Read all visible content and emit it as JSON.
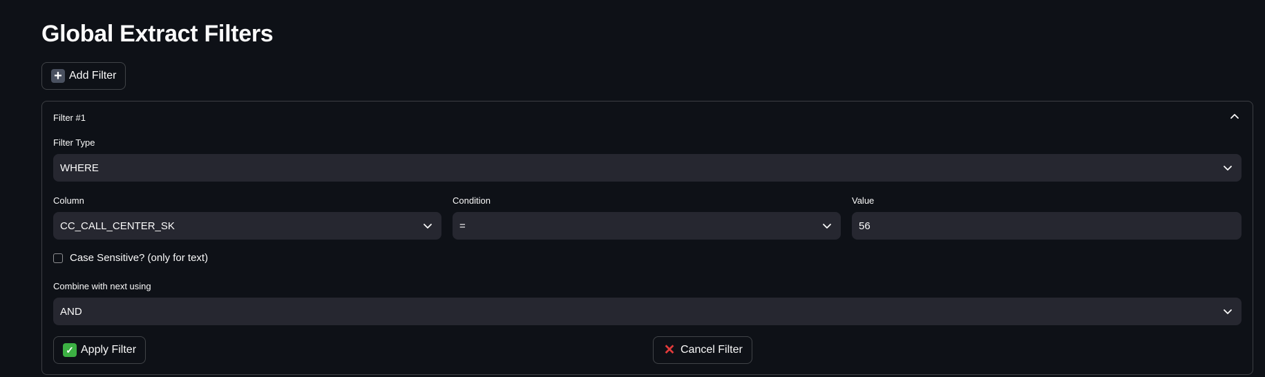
{
  "page": {
    "title": "Global Extract Filters"
  },
  "toolbar": {
    "add_filter_label": "Add Filter",
    "add_filter_icon": "heavy-plus-icon"
  },
  "filter": {
    "header": "Filter #1",
    "expanded": true,
    "filter_type": {
      "label": "Filter Type",
      "value": "WHERE"
    },
    "column": {
      "label": "Column",
      "value": "CC_CALL_CENTER_SK"
    },
    "condition": {
      "label": "Condition",
      "value": "="
    },
    "value": {
      "label": "Value",
      "value": "56"
    },
    "case_sensitive": {
      "label": "Case Sensitive? (only for text)",
      "checked": false
    },
    "combine": {
      "label": "Combine with next using",
      "value": "AND"
    },
    "apply_label": "Apply Filter",
    "apply_icon": "check-mark-icon",
    "cancel_label": "Cancel Filter",
    "cancel_icon": "cross-mark-icon"
  },
  "colors": {
    "background": "#0e1117",
    "field_background": "#262730",
    "text": "#fafafa",
    "check_green": "#3cb043",
    "cross_red": "#e23b3b"
  }
}
